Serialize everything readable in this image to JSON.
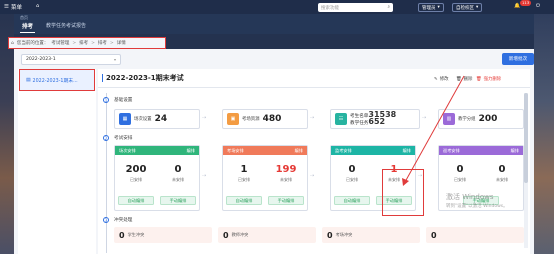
{
  "topbar": {
    "menu_label": "菜单",
    "search_placeholder": "搜索功能",
    "role_label": "管理员",
    "campus_label": "自检校区",
    "notice_count": "113"
  },
  "subnav": {
    "home_label": "首页",
    "tab_active": "排考",
    "tab_other": "教学任务考试报告"
  },
  "breadcrumb": {
    "prefix": "您当前的位置：",
    "items": [
      "考试管理",
      "排考",
      "排考",
      "详情"
    ]
  },
  "toolbar": {
    "year_value": "2022-2023-1",
    "new_button": "新增批次"
  },
  "sidebar": {
    "items": [
      {
        "label": "2022-2023-1期末..."
      }
    ]
  },
  "main": {
    "title": "2022-2023-1期末考试",
    "edit_label": "修改",
    "delete_label": "删除",
    "force_delete_label": "强力删除",
    "section1_title": "基础设置",
    "section2_title": "考试安排",
    "section3_title": "冲突处理",
    "info_cards": [
      {
        "label": "场次设置",
        "value": "24",
        "color": "#2f6fe0"
      },
      {
        "label": "考场资源",
        "value": "480",
        "color": "#f39c43"
      },
      {
        "label_a": "考生名单",
        "value_a": "31538",
        "label_b": "教学任务",
        "value_b": "652",
        "color": "#27b3a0"
      },
      {
        "label": "教学分组",
        "value": "200",
        "color": "#9b6ad8"
      }
    ],
    "arrange_cards": [
      {
        "head": "场次安排",
        "head_link": "编排",
        "color": "#2fb57b",
        "done": "200",
        "done_label": "已安排",
        "todo": "0",
        "todo_label": "未安排",
        "todo_red": false,
        "btn1": "自动编排",
        "btn2": "手动编排"
      },
      {
        "head": "考场安排",
        "head_link": "编排",
        "color": "#f07a5a",
        "done": "1",
        "done_label": "已安排",
        "todo": "199",
        "todo_label": "未安排",
        "todo_red": true,
        "btn1": "自动编排",
        "btn2": "手动编排"
      },
      {
        "head": "监考安排",
        "head_link": "编排",
        "color": "#1db5a5",
        "done": "0",
        "done_label": "已安排",
        "todo": "1",
        "todo_label": "未安排",
        "todo_red": true,
        "btn1": "自动编排",
        "btn2": "手动编排"
      },
      {
        "head": "巡考安排",
        "head_link": "编排",
        "color": "#9b6ad8",
        "done": "0",
        "done_label": "已安排",
        "todo": "0",
        "todo_label": "未安排",
        "todo_red": false,
        "btn1": "手动编排",
        "btn2": ""
      }
    ],
    "conflicts": [
      {
        "value": "0",
        "label": "学生冲突"
      },
      {
        "value": "0",
        "label": "教师冲突"
      },
      {
        "value": "0",
        "label": "考场冲突"
      },
      {
        "value": "0",
        "label": ""
      }
    ]
  },
  "watermark": {
    "line1": "激活 Windows",
    "line2": "转到\"设置\"以激活 Windows。"
  },
  "colors": {
    "accent": "#2f6fe0",
    "annotation_red": "#e03b3b"
  }
}
